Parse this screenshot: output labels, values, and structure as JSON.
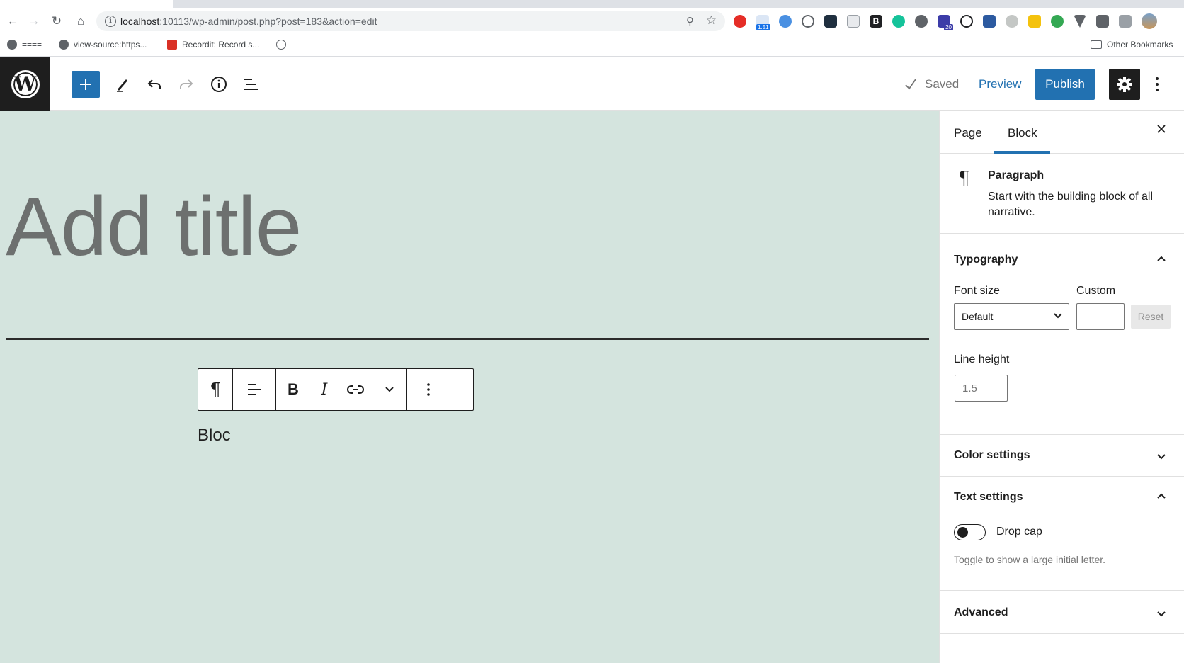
{
  "browser": {
    "url_host": "localhost",
    "url_rest": ":10113/wp-admin/post.php?post=183&action=edit",
    "bookmarks": [
      "====",
      "view-source:https...",
      "Recordit: Record s...",
      ""
    ],
    "other_bookmarks": "Other Bookmarks",
    "extension_badges": {
      "ext2": "1.51",
      "ext_school": "20"
    }
  },
  "header": {
    "saved_label": "Saved",
    "preview_label": "Preview",
    "publish_label": "Publish"
  },
  "canvas": {
    "title_placeholder": "Add title",
    "paragraph_text": "Bloc"
  },
  "sidebar": {
    "tabs": [
      {
        "label": "Page"
      },
      {
        "label": "Block"
      }
    ],
    "block_card": {
      "name": "Paragraph",
      "description": "Start with the building block of all narrative."
    },
    "typography": {
      "title": "Typography",
      "font_size_label": "Font size",
      "custom_label": "Custom",
      "font_size_value": "Default",
      "reset_label": "Reset",
      "line_height_label": "Line height",
      "line_height_placeholder": "1.5"
    },
    "color_settings": {
      "title": "Color settings"
    },
    "text_settings": {
      "title": "Text settings",
      "drop_cap_label": "Drop cap",
      "drop_cap_help": "Toggle to show a large initial letter."
    },
    "advanced": {
      "title": "Advanced"
    }
  },
  "colors": {
    "accent": "#2271b1",
    "canvas_bg": "#d4e4de",
    "dark": "#1e1e1e"
  }
}
